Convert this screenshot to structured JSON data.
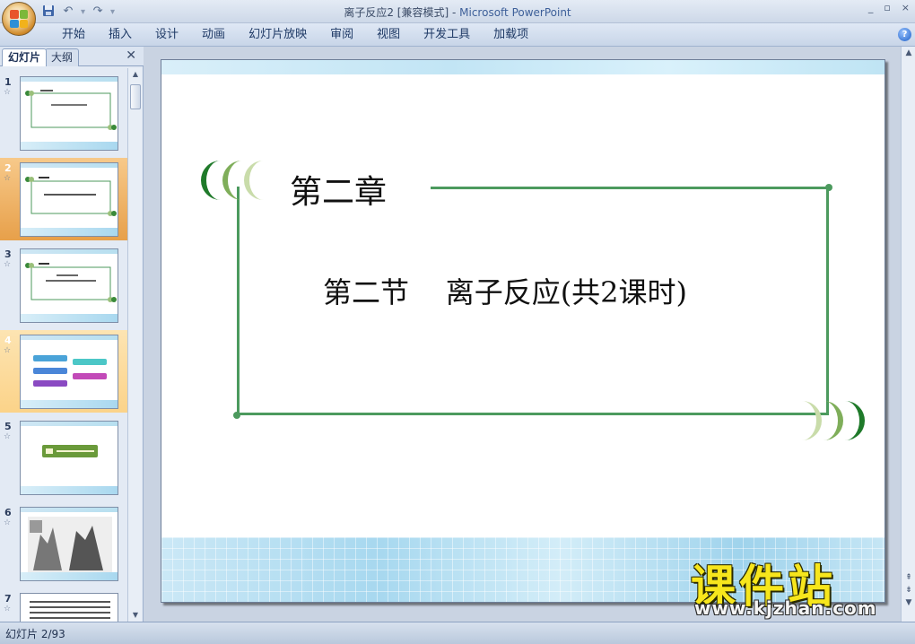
{
  "window": {
    "title": "离子反应2 [兼容模式] - ",
    "app_name": "Microsoft PowerPoint",
    "controls": [
      "_",
      "▫",
      "×"
    ]
  },
  "quick_access": {
    "icons": [
      "save-icon",
      "undo-icon",
      "redo-icon",
      "customize-icon"
    ]
  },
  "ribbon": {
    "tabs": [
      {
        "label": "开始"
      },
      {
        "label": "插入"
      },
      {
        "label": "设计"
      },
      {
        "label": "动画"
      },
      {
        "label": "幻灯片放映"
      },
      {
        "label": "审阅"
      },
      {
        "label": "视图"
      },
      {
        "label": "开发工具"
      },
      {
        "label": "加载项"
      }
    ],
    "help": "?"
  },
  "left_pane": {
    "tab_slides": "幻灯片",
    "tab_outline": "大纲",
    "close": "✕",
    "thumbnails": [
      {
        "num": "1",
        "star": "☆"
      },
      {
        "num": "2",
        "star": "☆"
      },
      {
        "num": "3",
        "star": "☆"
      },
      {
        "num": "4",
        "star": "☆"
      },
      {
        "num": "5",
        "star": "☆"
      },
      {
        "num": "6",
        "star": "☆"
      },
      {
        "num": "7",
        "star": "☆"
      }
    ],
    "selected_slide": 2
  },
  "slide": {
    "chapter_title": "第二章",
    "section_title": "第二节    离子反应(共2课时)",
    "accent_color": "#4c9a5e"
  },
  "statusbar": {
    "slide_counter": "幻灯片 2/93"
  },
  "watermark": {
    "text": "课件站",
    "url": "www.kjzhan.com"
  }
}
